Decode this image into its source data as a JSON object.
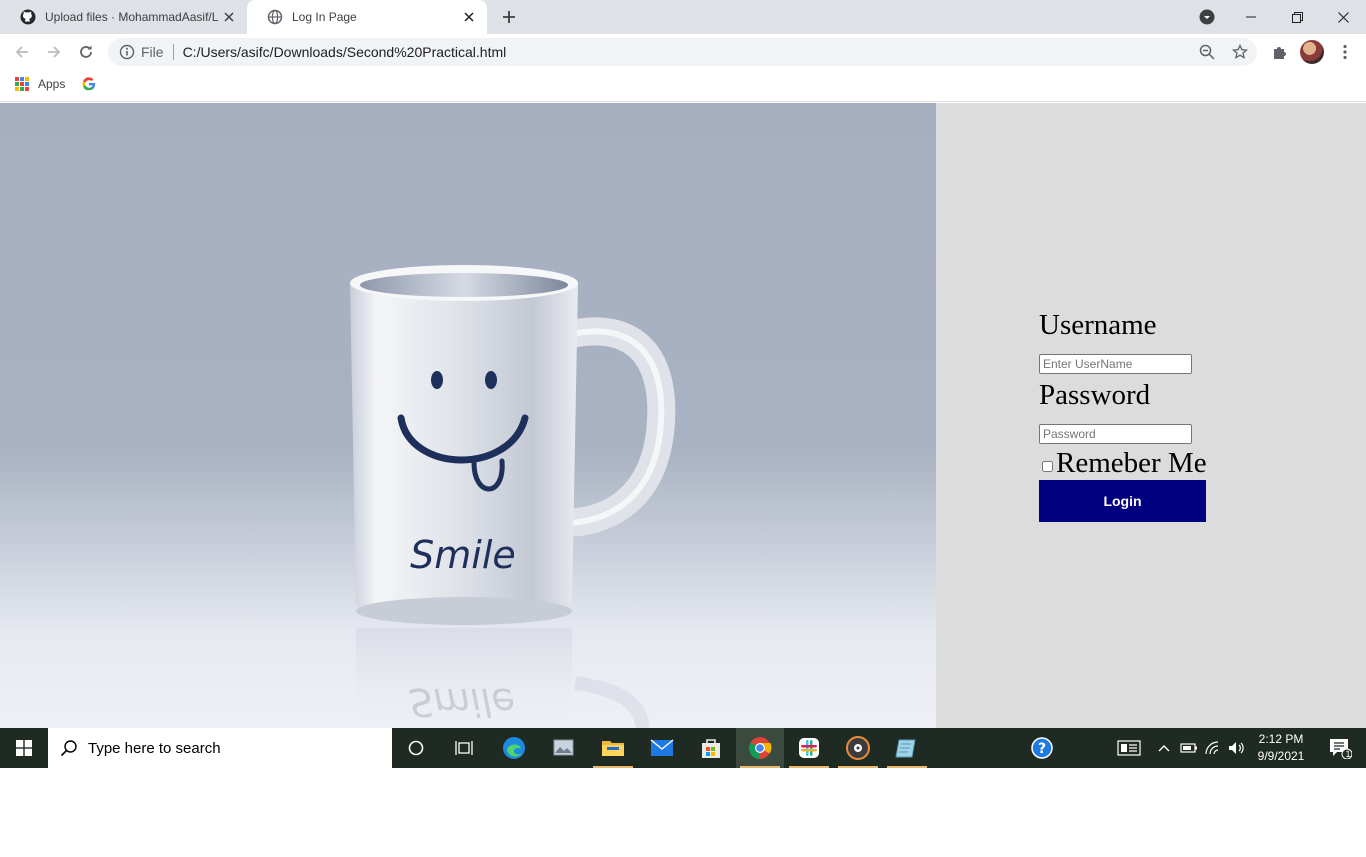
{
  "tabs": [
    {
      "title": "Upload files · MohammadAasif/L",
      "favicon": "github-icon"
    },
    {
      "title": "Log In Page",
      "favicon": "globe-icon"
    }
  ],
  "toolbar": {
    "scheme": "File",
    "url": "C:/Users/asifc/Downloads/Second%20Practical.html"
  },
  "bookmarks": {
    "apps_label": "Apps"
  },
  "hero": {
    "mug_text": "Smile"
  },
  "login": {
    "username_label": "Username",
    "username_placeholder": "Enter UserName",
    "password_label": "Password",
    "password_placeholder": "Password",
    "remember_label": "Remeber Me",
    "login_button": "Login"
  },
  "taskbar": {
    "search_placeholder": "Type here to search",
    "time": "2:12 PM",
    "date": "9/9/2021",
    "notification_count": "1"
  },
  "colors": {
    "login_button": "#000080",
    "panel_bg": "#dcdcdc",
    "taskbar_bg": "#1f2a22"
  }
}
